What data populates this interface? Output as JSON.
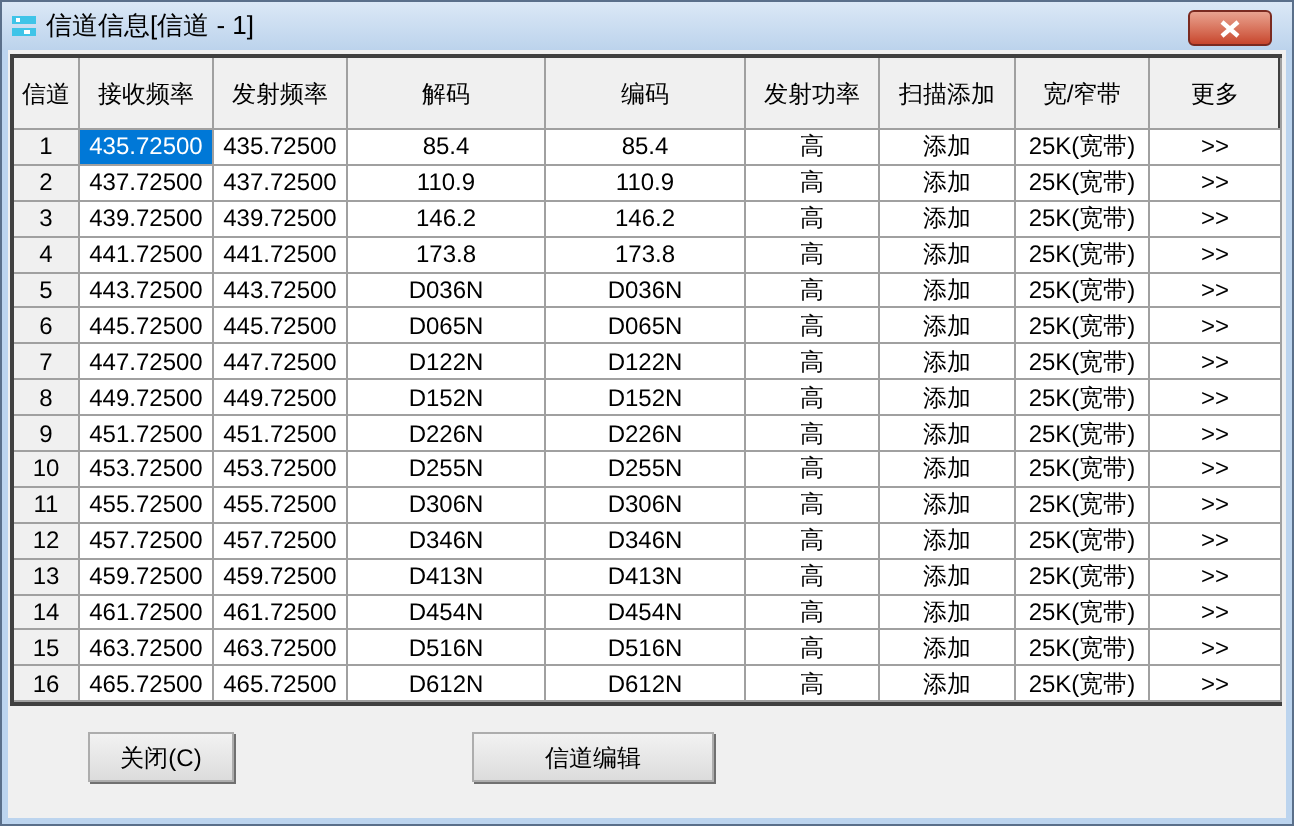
{
  "window": {
    "title": "信道信息[信道 - 1]"
  },
  "table": {
    "columns": [
      "信道",
      "接收频率",
      "发射频率",
      "解码",
      "编码",
      "发射功率",
      "扫描添加",
      "宽/窄带",
      "更多"
    ],
    "rows": [
      {
        "cells": [
          "1",
          "435.72500",
          "435.72500",
          "85.4",
          "85.4",
          "高",
          "添加",
          "25K(宽带)",
          ">>"
        ],
        "selected": true
      },
      {
        "cells": [
          "2",
          "437.72500",
          "437.72500",
          "110.9",
          "110.9",
          "高",
          "添加",
          "25K(宽带)",
          ">>"
        ],
        "selected": false
      },
      {
        "cells": [
          "3",
          "439.72500",
          "439.72500",
          "146.2",
          "146.2",
          "高",
          "添加",
          "25K(宽带)",
          ">>"
        ],
        "selected": false
      },
      {
        "cells": [
          "4",
          "441.72500",
          "441.72500",
          "173.8",
          "173.8",
          "高",
          "添加",
          "25K(宽带)",
          ">>"
        ],
        "selected": false
      },
      {
        "cells": [
          "5",
          "443.72500",
          "443.72500",
          "D036N",
          "D036N",
          "高",
          "添加",
          "25K(宽带)",
          ">>"
        ],
        "selected": false
      },
      {
        "cells": [
          "6",
          "445.72500",
          "445.72500",
          "D065N",
          "D065N",
          "高",
          "添加",
          "25K(宽带)",
          ">>"
        ],
        "selected": false
      },
      {
        "cells": [
          "7",
          "447.72500",
          "447.72500",
          "D122N",
          "D122N",
          "高",
          "添加",
          "25K(宽带)",
          ">>"
        ],
        "selected": false
      },
      {
        "cells": [
          "8",
          "449.72500",
          "449.72500",
          "D152N",
          "D152N",
          "高",
          "添加",
          "25K(宽带)",
          ">>"
        ],
        "selected": false
      },
      {
        "cells": [
          "9",
          "451.72500",
          "451.72500",
          "D226N",
          "D226N",
          "高",
          "添加",
          "25K(宽带)",
          ">>"
        ],
        "selected": false
      },
      {
        "cells": [
          "10",
          "453.72500",
          "453.72500",
          "D255N",
          "D255N",
          "高",
          "添加",
          "25K(宽带)",
          ">>"
        ],
        "selected": false
      },
      {
        "cells": [
          "11",
          "455.72500",
          "455.72500",
          "D306N",
          "D306N",
          "高",
          "添加",
          "25K(宽带)",
          ">>"
        ],
        "selected": false
      },
      {
        "cells": [
          "12",
          "457.72500",
          "457.72500",
          "D346N",
          "D346N",
          "高",
          "添加",
          "25K(宽带)",
          ">>"
        ],
        "selected": false
      },
      {
        "cells": [
          "13",
          "459.72500",
          "459.72500",
          "D413N",
          "D413N",
          "高",
          "添加",
          "25K(宽带)",
          ">>"
        ],
        "selected": false
      },
      {
        "cells": [
          "14",
          "461.72500",
          "461.72500",
          "D454N",
          "D454N",
          "高",
          "添加",
          "25K(宽带)",
          ">>"
        ],
        "selected": false
      },
      {
        "cells": [
          "15",
          "463.72500",
          "463.72500",
          "D516N",
          "D516N",
          "高",
          "添加",
          "25K(宽带)",
          ">>"
        ],
        "selected": false
      },
      {
        "cells": [
          "16",
          "465.72500",
          "465.72500",
          "D612N",
          "D612N",
          "高",
          "添加",
          "25K(宽带)",
          ">>"
        ],
        "selected": false
      }
    ]
  },
  "buttons": [
    "关闭(C)",
    "信道编辑"
  ]
}
